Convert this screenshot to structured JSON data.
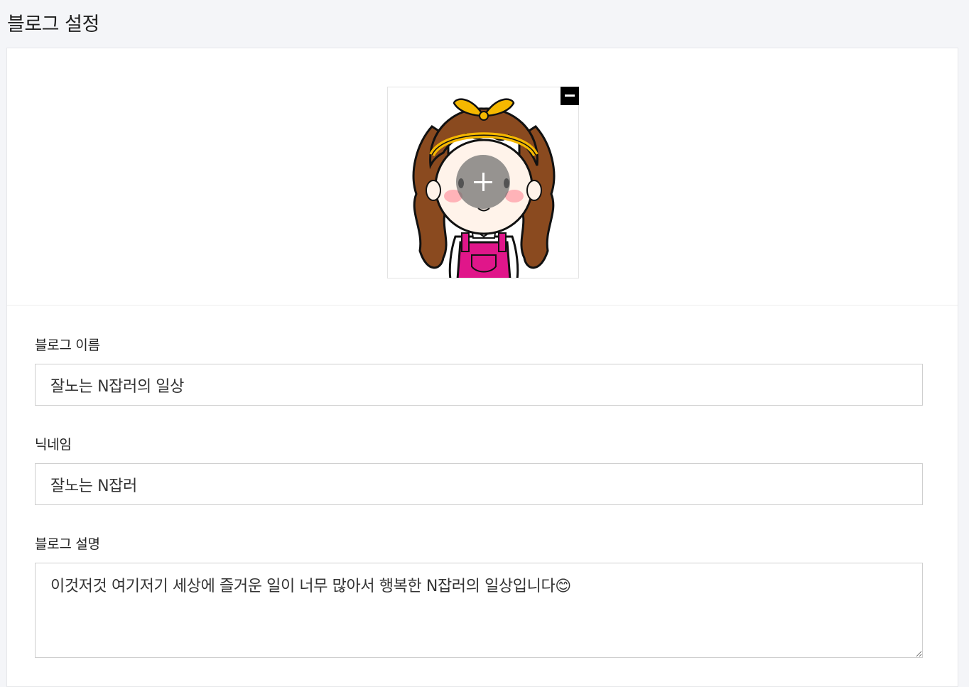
{
  "header": {
    "title": "블로그 설정"
  },
  "profile": {
    "avatar_icon": "girl-character-avatar",
    "remove_icon": "minus-icon",
    "upload_icon": "plus-icon"
  },
  "form": {
    "blog_name": {
      "label": "블로그 이름",
      "value": "잘노는 N잡러의 일상"
    },
    "nickname": {
      "label": "닉네임",
      "value": "잘노는 N잡러"
    },
    "description": {
      "label": "블로그 설명",
      "value": "이것저것 여기저기 세상에 즐거운 일이 너무 많아서 행복한 N잡러의 일상입니다😊"
    }
  },
  "colors": {
    "page_bg": "#f4f5f8",
    "panel_bg": "#ffffff",
    "border": "#cfcfcf"
  }
}
